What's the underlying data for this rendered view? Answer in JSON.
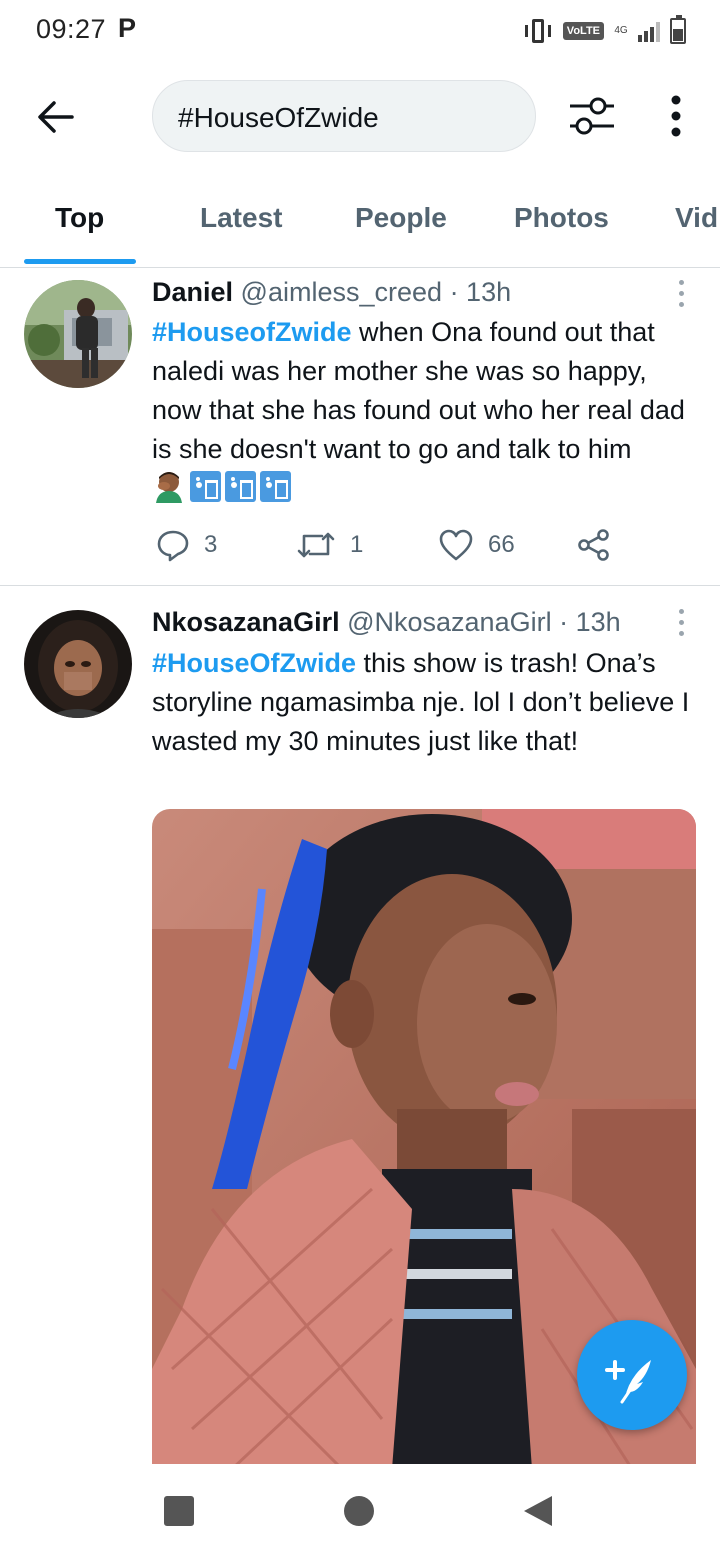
{
  "status_bar": {
    "time": "09:27",
    "notif_letter": "P",
    "volte": "VoLTE",
    "network": "4G"
  },
  "search": {
    "query": "#HouseOfZwide"
  },
  "tabs": [
    {
      "label": "Top",
      "active": true
    },
    {
      "label": "Latest"
    },
    {
      "label": "People"
    },
    {
      "label": "Photos"
    },
    {
      "label": "Vid"
    }
  ],
  "tweets": [
    {
      "name": "Daniel",
      "handle": "@aimless_creed",
      "time": "· 13h",
      "hashtag": "#HouseofZwide",
      "text": " when Ona found out that naledi was her mother she was so happy, now that she has found out who her real dad is she doesn't want to go and talk to him",
      "emoji_icons": [
        "facepalm-emoji",
        "trash-bin-emoji",
        "trash-bin-emoji",
        "trash-bin-emoji"
      ],
      "replies": "3",
      "retweets": "1",
      "likes": "66"
    },
    {
      "name": "NkosazanaGirl",
      "handle": "@NkosazanaGirl",
      "time": "· 13h",
      "hashtag": "#HouseOfZwide",
      "text": " this show is trash! Ona’s storyline ngamasimba nje.  lol I don’t believe I wasted my 30 minutes just like that!"
    }
  ],
  "colors": {
    "accent": "#1d9bf0",
    "text": "#0f1419",
    "muted": "#536471"
  }
}
